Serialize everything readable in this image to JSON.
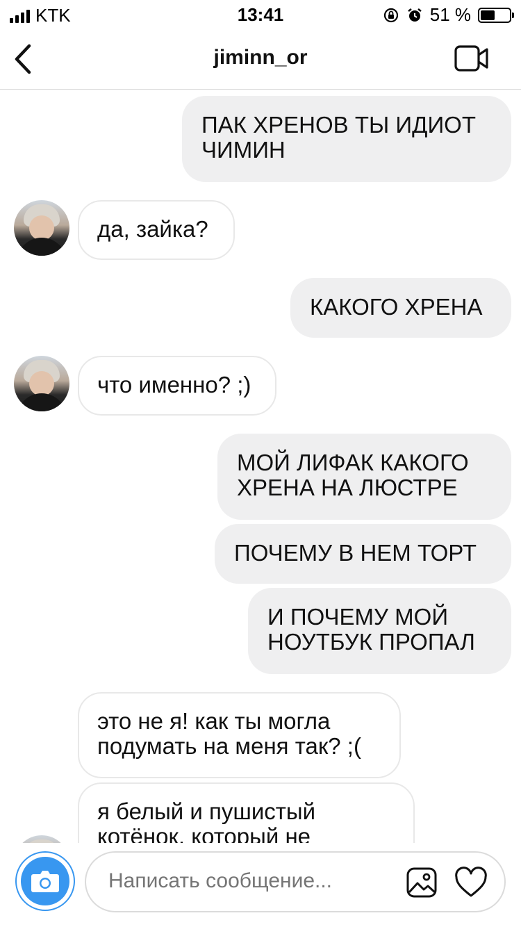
{
  "status_bar": {
    "carrier": "KTK",
    "time": "13:41",
    "battery_text": "51 %",
    "battery_level": 0.51
  },
  "header": {
    "title": "jiminn_or"
  },
  "messages": [
    {
      "direction": "out",
      "text": "ПАК ХРЕНОВ ТЫ ИДИОТ\nЧИМИН"
    },
    {
      "direction": "in",
      "text": "да, зайка?"
    },
    {
      "direction": "out",
      "text": "КАКОГО ХРЕНА"
    },
    {
      "direction": "in",
      "text": "что именно? ;)"
    },
    {
      "direction": "out",
      "text": "МОЙ ЛИФАК КАКОГО\nХРЕНА НА ЛЮСТРЕ"
    },
    {
      "direction": "out",
      "text": "ПОЧЕМУ В НЕМ ТОРТ"
    },
    {
      "direction": "out",
      "text": "И ПОЧЕМУ МОЙ\nНОУТБУК ПРОПАЛ"
    },
    {
      "direction": "in",
      "text": "это не я! как ты могла\nподумать на меня так? ;("
    },
    {
      "direction": "in",
      "text": "я белый и пушистый\nкотёнок, который не"
    }
  ],
  "composer": {
    "placeholder": "Написать сообщение..."
  },
  "icons": {
    "back": "chevron-left-icon",
    "video": "video-camera-icon",
    "camera": "camera-icon",
    "gallery": "image-icon",
    "heart": "heart-icon"
  },
  "colors": {
    "accent": "#3897f0",
    "outgoing_bubble": "#efeff0",
    "incoming_border": "#e8e8e8"
  }
}
